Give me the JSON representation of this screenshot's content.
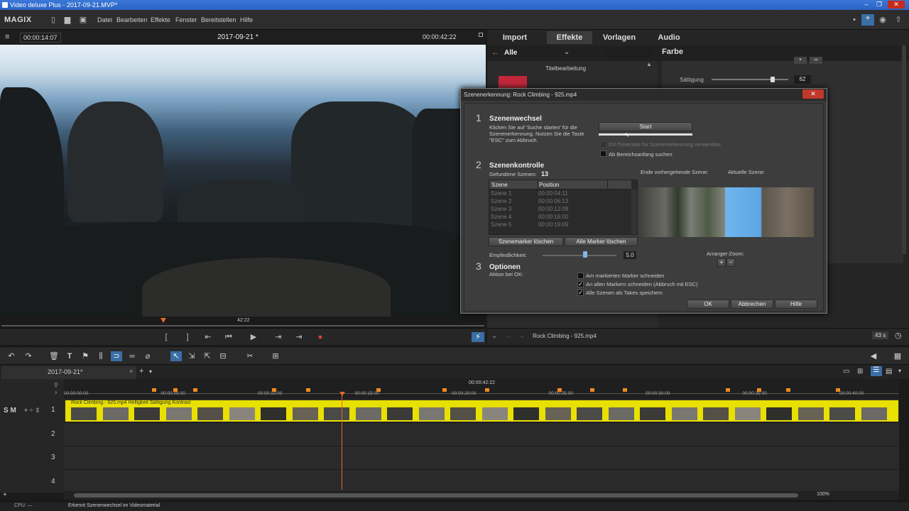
{
  "window": {
    "title": "Video deluxe Plus - 2017-09-21.MVP*"
  },
  "menu": {
    "logo": "MAGIX",
    "items": [
      "Datei",
      "Bearbeiten",
      "Effekte",
      "Fenster",
      "Bereitstellen",
      "Hilfe"
    ]
  },
  "preview": {
    "timecode_left": "00:00:14:07",
    "project": "2017-09-21 *",
    "timecode_right": "00:00:42:22",
    "scrub_label": "42:22"
  },
  "panel": {
    "tabs": [
      "Import",
      "Effekte",
      "Vorlagen",
      "Audio"
    ],
    "active_tab": "Effekte",
    "filter": "Alle",
    "category": "Titelbearbeitung",
    "section": "Farbe",
    "saturation_label": "Sättigung",
    "saturation_value": "62",
    "clip_name": "Rock Climbing - 925.mp4",
    "clip_duration": "43 s"
  },
  "dialog": {
    "title": "Szenenerkennung: Rock Climbing - 925.mp4",
    "s1_num": "1",
    "s1_title": "Szenenwechsel",
    "s1_text": "Klicken Sie auf 'Suche starten' für die Szenenerkennung. Nutzen Sie die Taste \"ESC\" zum Abbruch.",
    "start_label": "Start",
    "opt_dv": "DV-Timecode für Szenenerkennung verwenden",
    "opt_range": "Ab Bereichsanfang suchen",
    "s2_num": "2",
    "s2_title": "Szenenkontrolle",
    "found_label": "Gefundene Szenen:",
    "found_count": "13",
    "col_scene": "Szene",
    "col_position": "Position",
    "scenes": [
      {
        "name": "Szene 1",
        "pos": "00:00:04:11"
      },
      {
        "name": "Szene 2",
        "pos": "00:00:06:13"
      },
      {
        "name": "Szene 3",
        "pos": "00:00:12:09"
      },
      {
        "name": "Szene 4",
        "pos": "00:00:16:00"
      },
      {
        "name": "Szene 5",
        "pos": "00:00:19:09"
      }
    ],
    "btn_del_scene": "Szenemarker löschen",
    "btn_del_all": "Alle Marker löschen",
    "prev_scene_label": "Ende vorhergehende Szene:",
    "current_scene_label": "Aktuelle Szene:",
    "sensitivity_label": "Empfindlichkeit:",
    "sensitivity_value": "5.0",
    "arranger_zoom": "Arranger-Zoom:",
    "s3_num": "3",
    "s3_title": "Optionen",
    "s3_action": "Aktion bei OK:",
    "opt_cut_marked": "Am markierten Marker schneiden",
    "opt_cut_all": "An allen Markern schneiden (Abbruch mit ESC)",
    "opt_takes": "Alle Szenen als Takes speichern",
    "ok": "OK",
    "cancel": "Abbrechen",
    "help": "Hilfe"
  },
  "timeline": {
    "tab": "2017-09-21*",
    "playhead": "00:00:42:22",
    "ruler": [
      "00:00:00:00",
      "00:00:05:00",
      "00:00:10:00",
      "00:00:15:00",
      "00:00:20:00",
      "00:00:25:00",
      "00:00:30:00",
      "00:00:35:00",
      "00:00:40:00"
    ],
    "clip_label": "Rock Climbing - 925.mp4   Helligkeit  Sättigung  Kontrast",
    "tracks": [
      "1",
      "2",
      "3",
      "4"
    ],
    "track_ctrl": "S M",
    "zoom": "100%"
  },
  "status": {
    "cpu": "CPU: —",
    "message": "Erkennt Szenenwechsel im Videomaterial"
  }
}
